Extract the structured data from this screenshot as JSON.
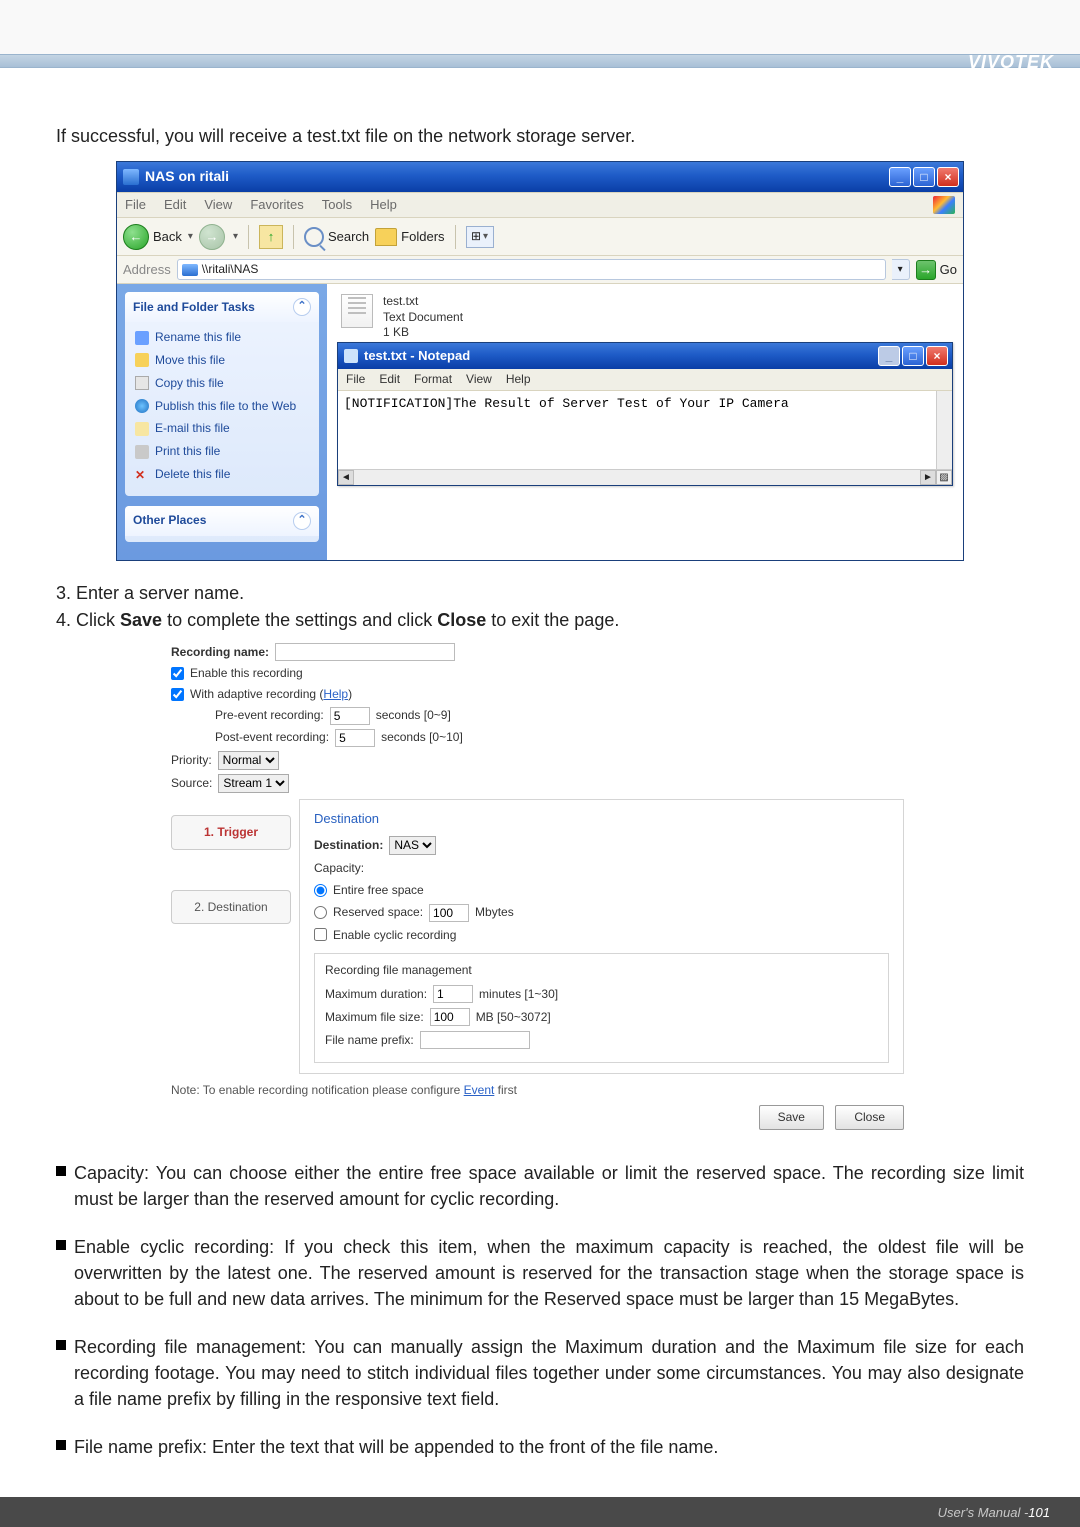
{
  "brand": "VIVOTEK",
  "intro": "If successful, you will receive a test.txt file on the network storage server.",
  "explorer": {
    "title": "NAS on ritali",
    "menu": [
      "File",
      "Edit",
      "View",
      "Favorites",
      "Tools",
      "Help"
    ],
    "toolbar": {
      "back": "Back",
      "search": "Search",
      "folders": "Folders"
    },
    "address_label": "Address",
    "address_value": "\\\\ritali\\NAS",
    "go": "Go",
    "panel1": {
      "title": "File and Folder Tasks",
      "items": [
        "Rename this file",
        "Move this file",
        "Copy this file",
        "Publish this file to the Web",
        "E-mail this file",
        "Print this file",
        "Delete this file"
      ]
    },
    "panel2": {
      "title": "Other Places"
    },
    "file": {
      "name": "test.txt",
      "type": "Text Document",
      "size": "1 KB"
    }
  },
  "notepad": {
    "title": "test.txt - Notepad",
    "menu": [
      "File",
      "Edit",
      "Format",
      "View",
      "Help"
    ],
    "content": "[NOTIFICATION]The Result of Server Test of Your IP Camera"
  },
  "steps": {
    "s3": "3. Enter a server name.",
    "s4_pre": "4. Click ",
    "s4_save": "Save",
    "s4_mid": " to complete the settings and click ",
    "s4_close": "Close",
    "s4_post": " to exit the page."
  },
  "rec": {
    "name_label": "Recording name:",
    "enable": "Enable this recording",
    "adaptive_pre": "With adaptive recording (",
    "adaptive_help": "Help",
    "adaptive_post": ")",
    "pre_label": "Pre-event recording:",
    "pre_val": "5",
    "pre_unit": "seconds [0~9]",
    "post_label": "Post-event recording:",
    "post_val": "5",
    "post_unit": "seconds [0~10]",
    "priority_label": "Priority:",
    "priority_val": "Normal",
    "source_label": "Source:",
    "source_val": "Stream 1",
    "tabs": {
      "trigger": "1. Trigger",
      "dest": "2. Destination"
    },
    "dest_legend": "Destination",
    "dest_label": "Destination:",
    "dest_val": "NAS",
    "cap_label": "Capacity:",
    "cap_opt1": "Entire free space",
    "cap_opt2": "Reserved space:",
    "cap_resv_val": "100",
    "cap_resv_unit": "Mbytes",
    "cyclic": "Enable cyclic recording",
    "rfm_legend": "Recording file management",
    "maxdur_label": "Maximum duration:",
    "maxdur_val": "1",
    "maxdur_unit": "minutes [1~30]",
    "maxsize_label": "Maximum file size:",
    "maxsize_val": "100",
    "maxsize_unit": "MB [50~3072]",
    "prefix_label": "File name prefix:",
    "note_pre": "Note: To enable recording notification please configure ",
    "note_link": "Event",
    "note_post": " first",
    "save_btn": "Save",
    "close_btn": "Close"
  },
  "bullets": {
    "b1": "Capacity: You can choose either the entire free space available or limit the reserved space. The recording size limit must be larger than the reserved amount for cyclic recording.",
    "b2": "Enable cyclic recording: If you check this item, when the maximum capacity is reached, the oldest file will be overwritten by the latest one. The reserved amount is reserved for the transaction stage when the storage space is about to be full and new data arrives. The minimum for the Reserved space must be larger than 15 MegaBytes.",
    "b3": "Recording file management: You can manually assign the Maximum duration and the Maximum file size for each recording footage. You may need to stitch individual files together under some circumstances. You may also designate a file name prefix by filling in the responsive text field.",
    "b4": "File name prefix: Enter the text that will be appended to the front of the file name."
  },
  "footer": {
    "label": "User's Manual - ",
    "page": "101"
  }
}
